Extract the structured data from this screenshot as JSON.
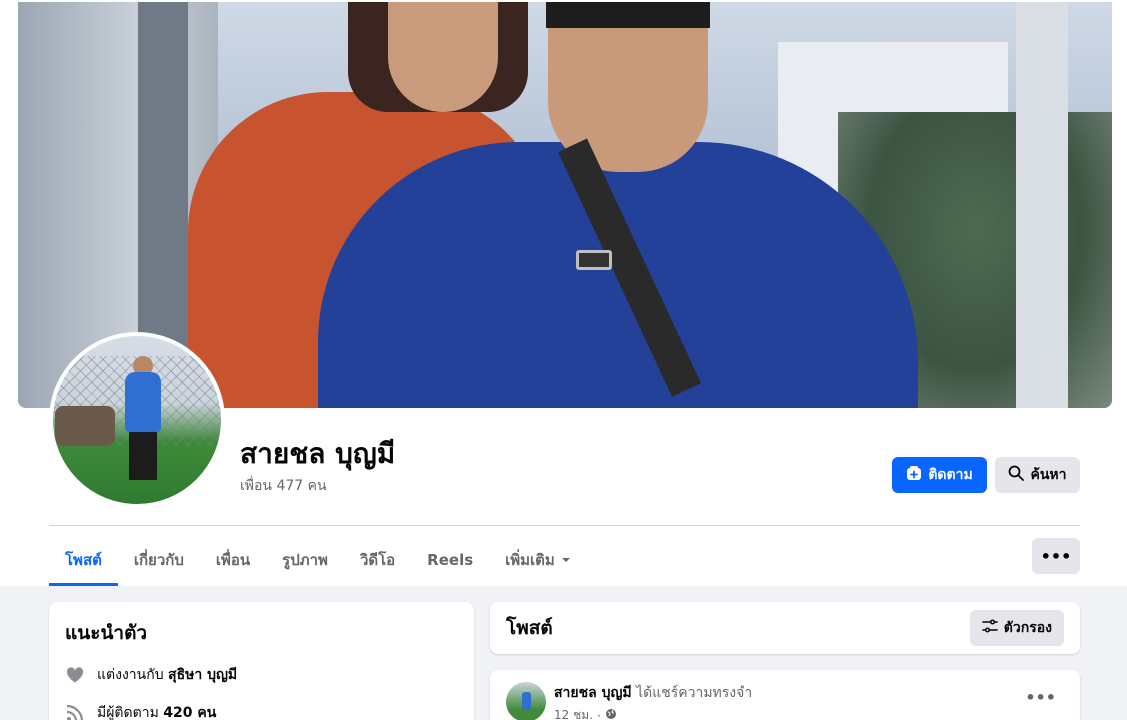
{
  "profile": {
    "name": "สายชล บุญมี",
    "friends_text": "เพื่อน 477 คน"
  },
  "actions": {
    "follow_label": "ติดตาม",
    "search_label": "ค้นหา"
  },
  "tabs": [
    {
      "label": "โพสต์",
      "active": true
    },
    {
      "label": "เกี่ยวกับ",
      "active": false
    },
    {
      "label": "เพื่อน",
      "active": false
    },
    {
      "label": "รูปภาพ",
      "active": false
    },
    {
      "label": "วิดีโอ",
      "active": false
    },
    {
      "label": "Reels",
      "active": false
    },
    {
      "label": "เพิ่มเติม",
      "active": false
    }
  ],
  "intro": {
    "title": "แนะนำตัว",
    "married_prefix": "แต่งงานกับ",
    "married_to": "สุธิษา บุญมี",
    "followers_prefix": "มีผู้ติดตาม",
    "followers_count": "420 คน"
  },
  "posts_section": {
    "title": "โพสต์",
    "filter_label": "ตัวกรอง"
  },
  "post": {
    "author": "สายชล บุญมี",
    "action": "ได้แชร์ความทรงจำ",
    "time": "12 ชม."
  },
  "colors": {
    "accent": "#0866ff",
    "button_gray": "#e4e6eb",
    "text_secondary": "#65676b"
  },
  "icons": [
    "add-friend-icon",
    "search-icon",
    "more-dots-icon",
    "chevron-down-icon",
    "heart-icon",
    "rss-icon",
    "filter-icon",
    "globe-icon"
  ]
}
